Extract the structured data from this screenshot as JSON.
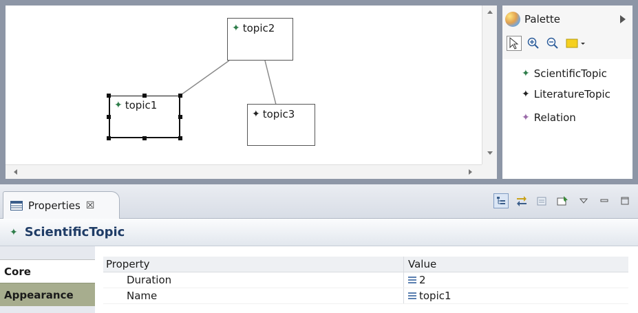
{
  "diagram": {
    "nodes": [
      {
        "label": "topic2",
        "type": "ScientificTopic"
      },
      {
        "label": "topic1",
        "type": "ScientificTopic",
        "selected": true
      },
      {
        "label": "topic3",
        "type": "LiteratureTopic"
      }
    ]
  },
  "palette": {
    "title": "Palette",
    "tools": [
      "select-tool",
      "zoom-in-tool",
      "zoom-out-tool",
      "note-tool"
    ],
    "items": [
      {
        "label": "ScientificTopic",
        "icon": "green-star-icon",
        "color": "#2e7d4a"
      },
      {
        "label": "LiteratureTopic",
        "icon": "black-star-icon",
        "color": "#222222"
      },
      {
        "label": "Relation",
        "icon": "purple-star-icon",
        "color": "#9a6aa8"
      }
    ]
  },
  "properties": {
    "tab_label": "Properties",
    "tab_close": "☒",
    "title": "ScientificTopic",
    "side_tabs": [
      "Core",
      "Appearance"
    ],
    "columns": [
      "Property",
      "Value"
    ],
    "rows": [
      {
        "property": "Duration",
        "value": "2"
      },
      {
        "property": "Name",
        "value": "topic1"
      }
    ]
  }
}
